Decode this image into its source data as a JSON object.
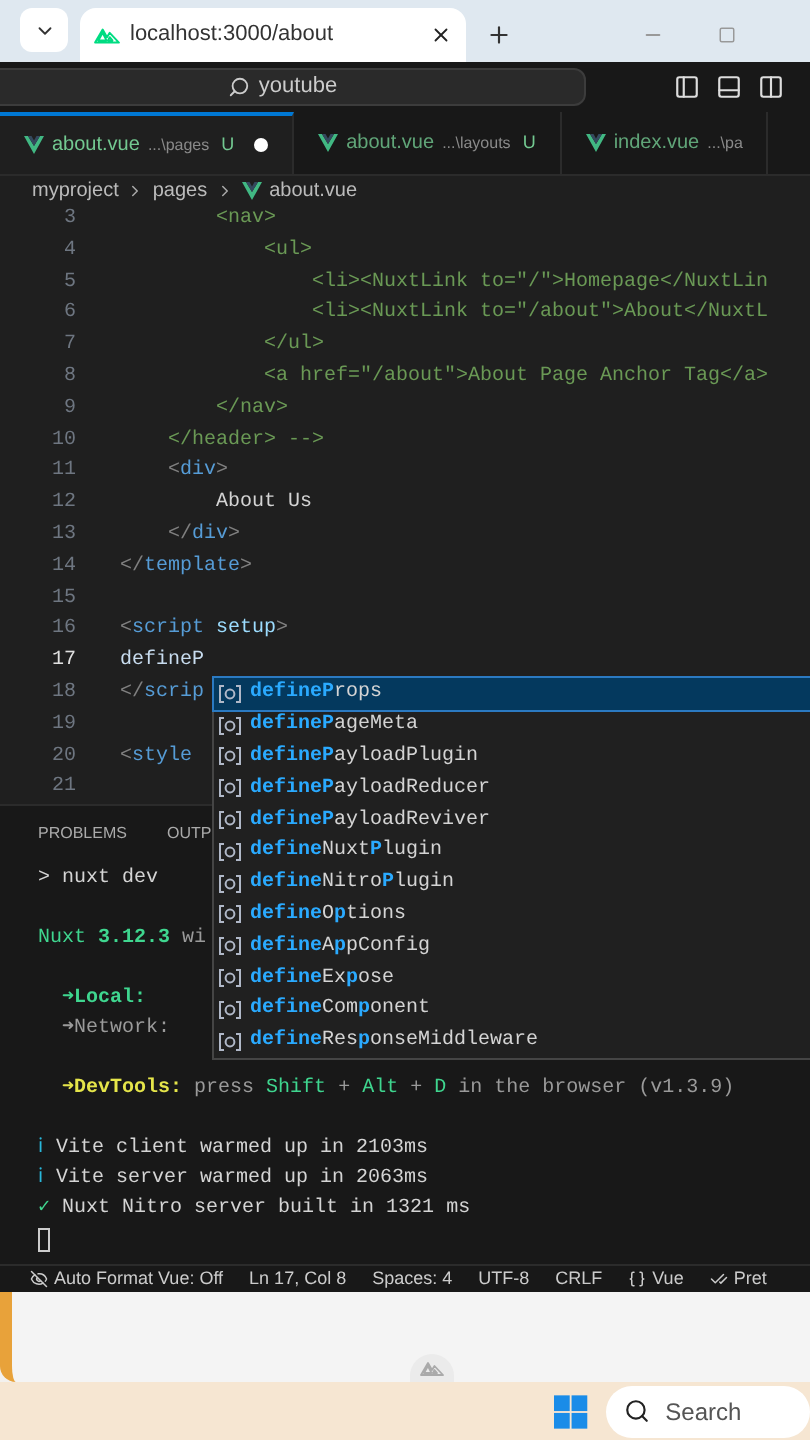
{
  "browser": {
    "tab_title": "localhost:3000/about"
  },
  "title_bar": {
    "search": "youtube"
  },
  "editor_tabs": [
    {
      "name": "about.vue",
      "path": "...\\pages",
      "badge": "U",
      "modified": true,
      "selected": true
    },
    {
      "name": "about.vue",
      "path": "...\\layouts",
      "badge": "U",
      "modified": false,
      "selected": false
    },
    {
      "name": "index.vue",
      "path": "...\\pa",
      "modified": false,
      "selected": false
    }
  ],
  "breadcrumb": [
    "myproject",
    "pages",
    "about.vue"
  ],
  "editor": {
    "lines": [
      {
        "number": "3",
        "current": false,
        "tokens": [
          {
            "kind": "comment",
            "text": "        <nav>"
          }
        ]
      },
      {
        "number": "4",
        "current": false,
        "tokens": [
          {
            "kind": "comment",
            "text": "            <ul>"
          }
        ]
      },
      {
        "number": "5",
        "current": false,
        "tokens": [
          {
            "kind": "comment",
            "text": "                <li><NuxtLink to=\"/\">Homepage</NuxtLin"
          }
        ]
      },
      {
        "number": "6",
        "current": false,
        "tokens": [
          {
            "kind": "comment",
            "text": "                <li><NuxtLink to=\"/about\">About</NuxtL"
          }
        ]
      },
      {
        "number": "7",
        "current": false,
        "tokens": [
          {
            "kind": "comment",
            "text": "            </ul>"
          }
        ]
      },
      {
        "number": "8",
        "current": false,
        "tokens": [
          {
            "kind": "comment",
            "text": "            <a href=\"/about\">About Page Anchor Tag</a>"
          }
        ]
      },
      {
        "number": "9",
        "current": false,
        "tokens": [
          {
            "kind": "comment",
            "text": "        </nav>"
          }
        ]
      },
      {
        "number": "10",
        "current": false,
        "tokens": [
          {
            "kind": "comment",
            "text": "    </header> -->"
          }
        ]
      },
      {
        "number": "11",
        "current": false,
        "tokens": [
          {
            "kind": "punct",
            "text": "    <"
          },
          {
            "kind": "tag",
            "text": "div"
          },
          {
            "kind": "punct",
            "text": ">"
          }
        ]
      },
      {
        "number": "12",
        "current": false,
        "tokens": [
          {
            "kind": "text",
            "text": "        About Us"
          }
        ]
      },
      {
        "number": "13",
        "current": false,
        "tokens": [
          {
            "kind": "punct",
            "text": "    </"
          },
          {
            "kind": "tag",
            "text": "div"
          },
          {
            "kind": "punct",
            "text": ">"
          }
        ]
      },
      {
        "number": "14",
        "current": false,
        "tokens": [
          {
            "kind": "punct",
            "text": "</"
          },
          {
            "kind": "tag",
            "text": "template"
          },
          {
            "kind": "punct",
            "text": ">"
          }
        ]
      },
      {
        "number": "15",
        "current": false
      },
      {
        "number": "16",
        "current": false,
        "tokens": [
          {
            "kind": "punct",
            "text": "<"
          },
          {
            "kind": "tag",
            "text": "script"
          },
          {
            "kind": "attr",
            "text": " setup"
          },
          {
            "kind": "punct",
            "text": ">"
          }
        ]
      },
      {
        "number": "17",
        "current": true,
        "tokens": [
          {
            "kind": "ident",
            "text": "defineP"
          }
        ]
      },
      {
        "number": "18",
        "current": false,
        "tokens": [
          {
            "kind": "punct",
            "text": "</"
          },
          {
            "kind": "tag",
            "text": "scrip"
          }
        ]
      },
      {
        "number": "19",
        "current": false
      },
      {
        "number": "20",
        "current": false,
        "tokens": [
          {
            "kind": "punct",
            "text": "<"
          },
          {
            "kind": "tag",
            "text": "style"
          }
        ]
      },
      {
        "number": "21",
        "current": false
      }
    ]
  },
  "suggestions": [
    {
      "selected": true,
      "parts": [
        {
          "text": "defineP",
          "match": true
        },
        {
          "text": "rops",
          "match": false
        }
      ]
    },
    {
      "selected": false,
      "parts": [
        {
          "text": "defineP",
          "match": true
        },
        {
          "text": "ageMeta",
          "match": false
        }
      ]
    },
    {
      "selected": false,
      "parts": [
        {
          "text": "defineP",
          "match": true
        },
        {
          "text": "ayloadPlugin",
          "match": false
        }
      ]
    },
    {
      "selected": false,
      "parts": [
        {
          "text": "defineP",
          "match": true
        },
        {
          "text": "ayloadReducer",
          "match": false
        }
      ]
    },
    {
      "selected": false,
      "parts": [
        {
          "text": "defineP",
          "match": true
        },
        {
          "text": "ayloadReviver",
          "match": false
        }
      ]
    },
    {
      "selected": false,
      "parts": [
        {
          "text": "define",
          "match": true
        },
        {
          "text": "Nuxt",
          "match": false
        },
        {
          "text": "P",
          "match": true
        },
        {
          "text": "lugin",
          "match": false
        }
      ]
    },
    {
      "selected": false,
      "parts": [
        {
          "text": "define",
          "match": true
        },
        {
          "text": "Nitro",
          "match": false
        },
        {
          "text": "P",
          "match": true
        },
        {
          "text": "lugin",
          "match": false
        }
      ]
    },
    {
      "selected": false,
      "parts": [
        {
          "text": "define",
          "match": true
        },
        {
          "text": "O",
          "match": false
        },
        {
          "text": "p",
          "match": true
        },
        {
          "text": "tions",
          "match": false
        }
      ]
    },
    {
      "selected": false,
      "parts": [
        {
          "text": "define",
          "match": true
        },
        {
          "text": "A",
          "match": false
        },
        {
          "text": "p",
          "match": true
        },
        {
          "text": "pConfig",
          "match": false
        }
      ]
    },
    {
      "selected": false,
      "parts": [
        {
          "text": "define",
          "match": true
        },
        {
          "text": "Ex",
          "match": false
        },
        {
          "text": "p",
          "match": true
        },
        {
          "text": "ose",
          "match": false
        }
      ]
    },
    {
      "selected": false,
      "parts": [
        {
          "text": "define",
          "match": true
        },
        {
          "text": "Com",
          "match": false
        },
        {
          "text": "p",
          "match": true
        },
        {
          "text": "onent",
          "match": false
        }
      ]
    },
    {
      "selected": false,
      "parts": [
        {
          "text": "define",
          "match": true
        },
        {
          "text": "Res",
          "match": false
        },
        {
          "text": "p",
          "match": true
        },
        {
          "text": "onseMiddleware",
          "match": false
        }
      ]
    }
  ],
  "panel": {
    "tabs": [
      "PROBLEMS",
      "OUTP"
    ],
    "lines": [
      {
        "kind": "line",
        "tokens": [
          {
            "kind": "text",
            "text": "> nuxt dev"
          }
        ]
      },
      {
        "kind": "blank"
      },
      {
        "kind": "line",
        "tokens": [
          {
            "kind": "green",
            "text": "Nuxt "
          },
          {
            "kind": "green_bold",
            "text": "3.12.3"
          },
          {
            "kind": "dim",
            "text": " wi"
          }
        ]
      },
      {
        "kind": "blank"
      },
      {
        "kind": "line",
        "tokens": [
          {
            "kind": "green_bold",
            "text": "  ➜Local:"
          }
        ]
      },
      {
        "kind": "line",
        "tokens": [
          {
            "kind": "dim",
            "text": "  ➜Network:"
          }
        ]
      },
      {
        "kind": "blank"
      },
      {
        "kind": "line",
        "tokens": [
          {
            "kind": "yellow",
            "text": "  ➜DevTools:"
          },
          {
            "kind": "dim",
            "text": " press "
          },
          {
            "kind": "green",
            "text": "Shift"
          },
          {
            "kind": "dim",
            "text": " + "
          },
          {
            "kind": "green",
            "text": "Alt"
          },
          {
            "kind": "dim",
            "text": " + "
          },
          {
            "kind": "green",
            "text": "D"
          },
          {
            "kind": "dim",
            "text": " in the browser (v1.3.9)"
          }
        ]
      },
      {
        "kind": "blank"
      },
      {
        "kind": "line",
        "tokens": [
          {
            "kind": "cyan",
            "text": "ℹ"
          },
          {
            "kind": "text",
            "text": " Vite client warmed up in 2103ms"
          }
        ]
      },
      {
        "kind": "line",
        "tokens": [
          {
            "kind": "cyan",
            "text": "ℹ"
          },
          {
            "kind": "text",
            "text": " Vite server warmed up in 2063ms"
          }
        ]
      },
      {
        "kind": "line",
        "tokens": [
          {
            "kind": "green",
            "text": "✓"
          },
          {
            "kind": "text",
            "text": " Nuxt Nitro server built in 1321 ms"
          }
        ]
      },
      {
        "kind": "cursor"
      }
    ]
  },
  "status_bar": [
    {
      "kind": "format_toggle",
      "text": "Auto Format Vue: Off"
    },
    {
      "kind": "plain",
      "text": "Ln 17, Col 8"
    },
    {
      "kind": "plain",
      "text": "Spaces: 4"
    },
    {
      "kind": "plain",
      "text": "UTF-8"
    },
    {
      "kind": "plain",
      "text": "CRLF"
    },
    {
      "kind": "language",
      "text": "Vue"
    },
    {
      "kind": "formatter",
      "text": "Pret"
    }
  ],
  "taskbar": {
    "search": "Search"
  }
}
